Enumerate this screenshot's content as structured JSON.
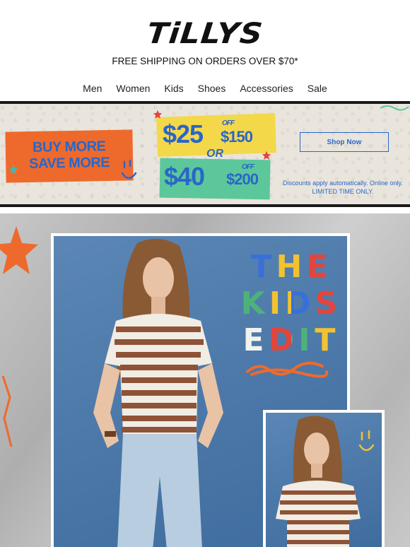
{
  "brand": {
    "logo_text": "TiLLYS"
  },
  "header": {
    "shipping_text": "FREE SHIPPING ON ORDERS OVER $70*"
  },
  "nav": {
    "items": [
      "Men",
      "Women",
      "Kids",
      "Shoes",
      "Accessories",
      "Sale"
    ]
  },
  "promo": {
    "headline_line1": "BUY MORE",
    "headline_line2": "SAVE MORE",
    "offer1_amount": "$25",
    "offer1_off": "OFF",
    "offer1_threshold": "$150",
    "or_text": "OR",
    "offer2_amount": "$40",
    "offer2_off": "OFF",
    "offer2_threshold": "$200",
    "shop_now_label": "Shop Now",
    "disclaimer_line1": "Discounts apply automatically. Online only.",
    "disclaimer_line2": "LIMITED TIME ONLY."
  },
  "hero": {
    "title_line1": "THE",
    "title_line2": "KIDS",
    "title_line3": "EDIT"
  },
  "colors": {
    "accent_blue": "#2a66c9",
    "promo_orange": "#ee6a2c",
    "promo_yellow": "#f3d84a",
    "promo_green": "#5cc79b",
    "title_blue": "#3a6fd8",
    "title_yellow": "#f2c230",
    "title_red": "#e2453c",
    "title_green": "#4db27a",
    "title_white": "#f2f2ee"
  }
}
